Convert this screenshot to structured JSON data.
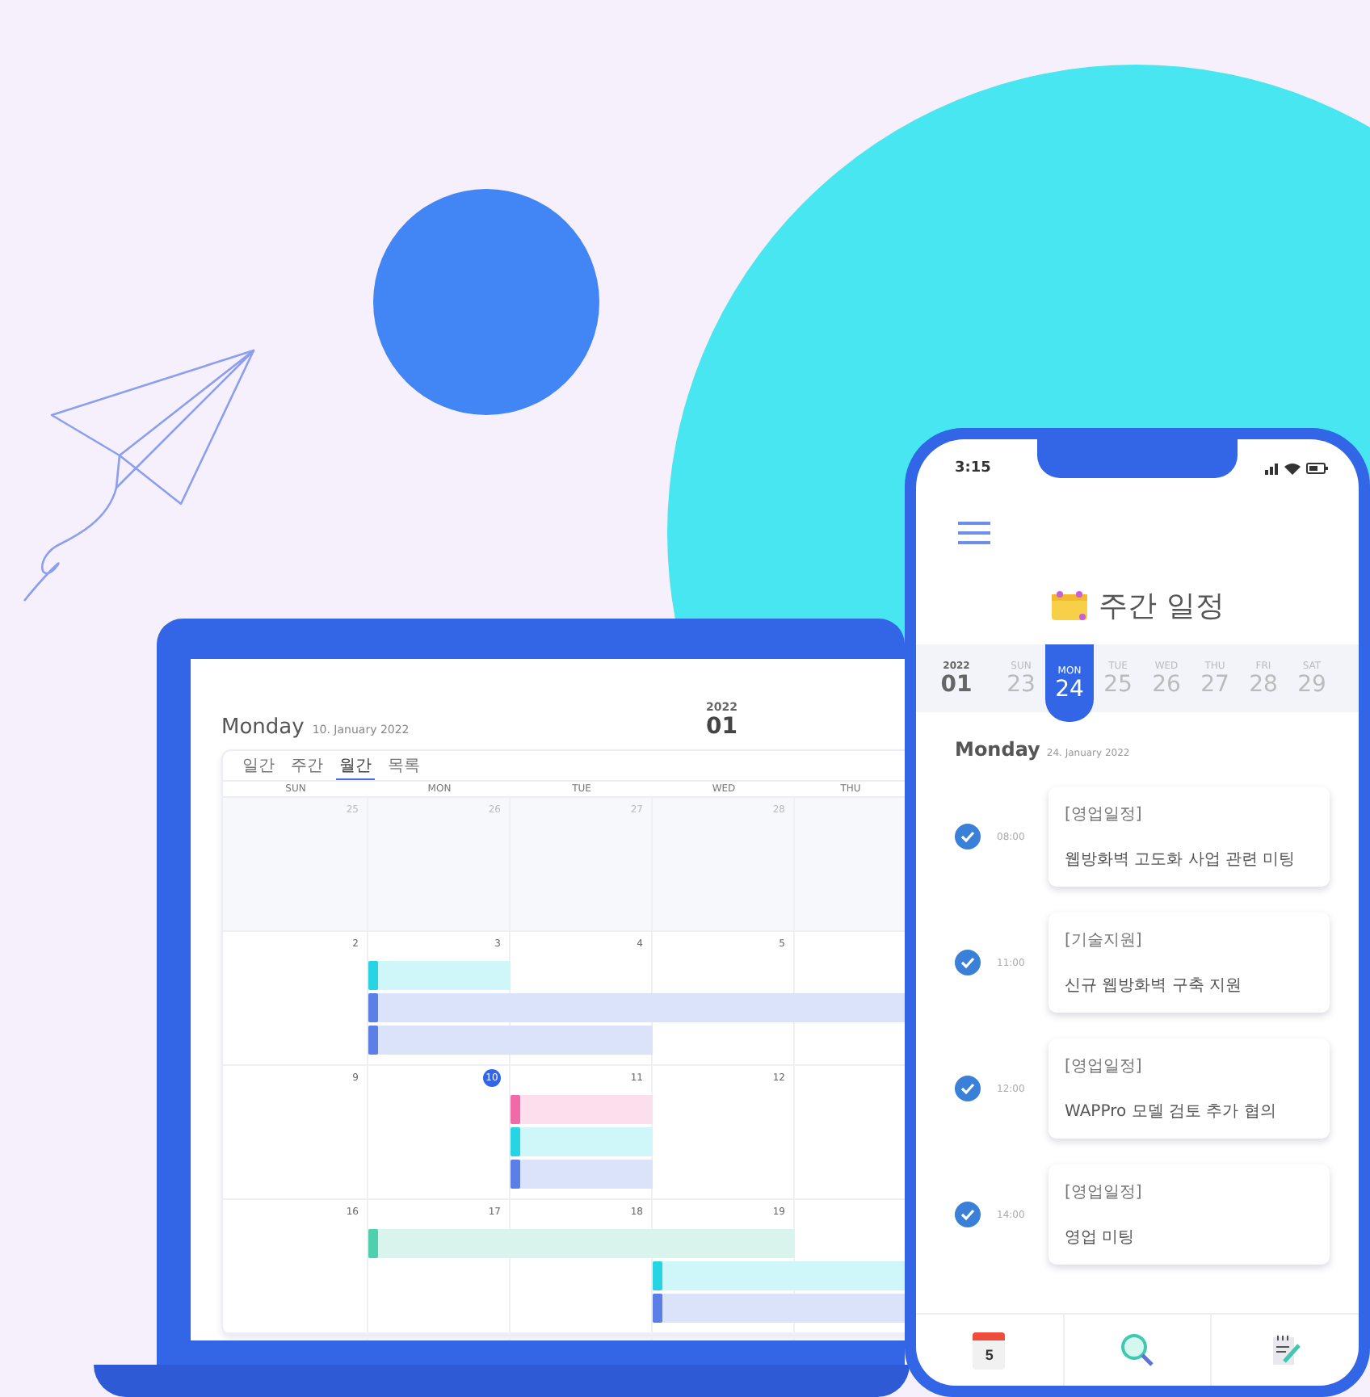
{
  "laptop": {
    "day_title": "Monday",
    "date": "10. January 2022",
    "year": "2022",
    "month": "01",
    "view_tabs": [
      {
        "label": "일간",
        "selected": false
      },
      {
        "label": "주간",
        "selected": false
      },
      {
        "label": "월간",
        "selected": true
      },
      {
        "label": "목록",
        "selected": false
      }
    ],
    "weekdays": [
      "SUN",
      "MON",
      "TUE",
      "WED",
      "THU"
    ],
    "weeks": [
      {
        "outside": true,
        "days": [
          {
            "num": "25",
            "today": false
          },
          {
            "num": "26",
            "today": false
          },
          {
            "num": "27",
            "today": false
          },
          {
            "num": "28",
            "today": false
          }
        ]
      },
      {
        "outside": false,
        "days": [
          {
            "num": "2",
            "today": false
          },
          {
            "num": "3",
            "today": false
          },
          {
            "num": "4",
            "today": false
          },
          {
            "num": "5",
            "today": false
          }
        ],
        "events": [
          {
            "color": "#26d4e4"
          },
          {
            "color": "#5b7fe6"
          },
          {
            "color": "#5b7fe6"
          }
        ]
      },
      {
        "outside": false,
        "days": [
          {
            "num": "9",
            "today": false
          },
          {
            "num": "10",
            "today": true
          },
          {
            "num": "11",
            "today": false
          },
          {
            "num": "12",
            "today": false
          }
        ],
        "events": [
          {
            "color": "#f06aa8"
          },
          {
            "color": "#26d4e4"
          },
          {
            "color": "#5b7fe6"
          }
        ]
      },
      {
        "outside": false,
        "days": [
          {
            "num": "16",
            "today": false
          },
          {
            "num": "17",
            "today": false
          },
          {
            "num": "18",
            "today": false
          },
          {
            "num": "19",
            "today": false
          }
        ],
        "events": [
          {
            "color": "#4fcfae"
          },
          {
            "color": "#26d4e4"
          },
          {
            "color": "#5b7fe6"
          }
        ]
      }
    ]
  },
  "phone": {
    "status_time": "3:15",
    "title": "주간 일정",
    "month_label": {
      "year": "2022",
      "month": "01"
    },
    "days": [
      {
        "label": "SUN",
        "num": "23",
        "selected": false
      },
      {
        "label": "MON",
        "num": "24",
        "selected": true
      },
      {
        "label": "TUE",
        "num": "25",
        "selected": false
      },
      {
        "label": "WED",
        "num": "26",
        "selected": false
      },
      {
        "label": "THU",
        "num": "27",
        "selected": false
      },
      {
        "label": "FRI",
        "num": "28",
        "selected": false
      },
      {
        "label": "SAT",
        "num": "29",
        "selected": false
      }
    ],
    "day_title": "Monday",
    "date": "24. January 2022",
    "schedule": [
      {
        "time": "08:00",
        "category": "[영업일정]",
        "title": "웹방화벽 고도화 사업 관련 미팅",
        "checked": true
      },
      {
        "time": "11:00",
        "category": "[기술지원]",
        "title": "신규 웹방화벽 구축 지원",
        "checked": true
      },
      {
        "time": "12:00",
        "category": "[영업일정]",
        "title": "WAPPro 모델 검토 추가 협의",
        "checked": true
      },
      {
        "time": "14:00",
        "category": "[영업일정]",
        "title": "영업 미팅",
        "checked": true
      }
    ],
    "tab_bar": [
      {
        "kind": "calendar",
        "number": "5"
      },
      {
        "kind": "search"
      },
      {
        "kind": "memo"
      }
    ]
  }
}
